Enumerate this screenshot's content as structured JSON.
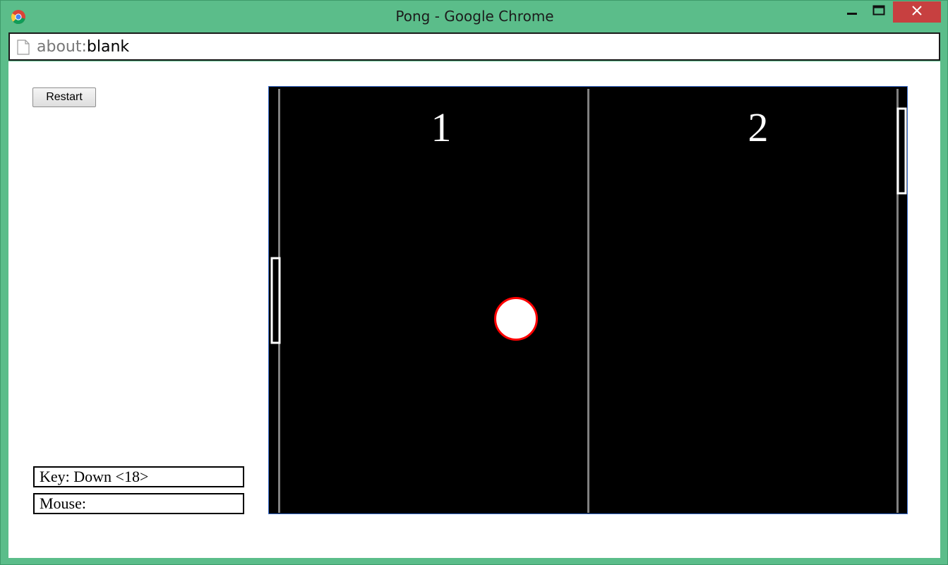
{
  "window": {
    "title": "Pong - Google Chrome"
  },
  "address_bar": {
    "scheme": "about:",
    "path": "blank"
  },
  "controls": {
    "restart_label": "Restart"
  },
  "status": {
    "key_label": "Key: Down <18>",
    "mouse_label": "Mouse:"
  },
  "game": {
    "score_left": "1",
    "score_right": "2",
    "colors": {
      "background": "#000000",
      "lines": "#808080",
      "paddle": "#ffffff",
      "ball_fill": "#ffffff",
      "ball_stroke": "#ff0000"
    }
  },
  "icons": {
    "app": "chrome-logo-icon",
    "page": "page-icon",
    "minimize": "minimize-icon",
    "maximize": "maximize-icon",
    "close": "close-icon"
  }
}
